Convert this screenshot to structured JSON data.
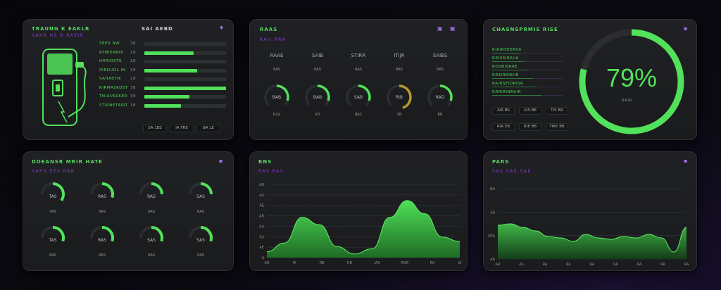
{
  "colors": {
    "accent": "#52e15b",
    "purple": "#8a3bd6",
    "panel": "#1d1e20",
    "amber": "#b59a2a"
  },
  "p1": {
    "title": "TRAUNG K EAKLR",
    "subtitle": "SAKR HS B RAEIR",
    "header_mid": "SAI AEBD",
    "icon": "battery-icon",
    "labels": [
      "SEER NW",
      "RTMIEANHI",
      "HRRIOSTE",
      "IRRDUOL IN",
      "SAHAETIK",
      "RIRMASKOST",
      "TNIAUSSKER",
      "STIRNETAIRT"
    ],
    "values": [
      "36",
      "18",
      "18",
      "18",
      "18",
      "38",
      "38",
      "18"
    ],
    "bars": [
      0.0,
      0.6,
      0.0,
      0.65,
      0.0,
      1.0,
      0.55,
      0.45
    ],
    "chips": [
      "SA 1EE",
      "IA FRE",
      "BA LE"
    ]
  },
  "p2": {
    "title": "RAAS",
    "subtitle": "RAH RRA",
    "gauges": [
      {
        "head": "RAAE",
        "sub": "RAS",
        "val": "BAB",
        "label": "R2G",
        "level": 0.3,
        "color": "#52e15b"
      },
      {
        "head": "SAIB",
        "sub": "RAS",
        "val": "BAB",
        "label": "R3",
        "level": 0.3,
        "color": "#52e15b"
      },
      {
        "head": "STIRR",
        "sub": "RAS",
        "val": "SAB",
        "label": "BA2",
        "level": 0.3,
        "color": "#52e15b"
      },
      {
        "head": "ITIJR",
        "sub": "RAS",
        "val": "RIB",
        "label": "ZB",
        "level": 0.45,
        "color": "#b59a2a"
      },
      {
        "head": "SAIBS",
        "sub": "RAS",
        "val": "RAD",
        "label": "BR",
        "level": 0.3,
        "color": "#52e15b"
      }
    ]
  },
  "p3": {
    "title": "CHASNSPRMIS RISE",
    "percent_label": "79%",
    "percent": 0.79,
    "gauge_caption": "RAIR",
    "rows": [
      "RIAIRSEERSA",
      "RRISSIRAIIA",
      "ROSNISRAE",
      "RRSIRAIEIIR",
      "RAIRSEIDRISR",
      "RRRIRINRAIR"
    ],
    "chips_row1": [
      "AIS BS",
      "UIS BE",
      "TIS BR"
    ],
    "chips_row2": [
      "RIA EB",
      "RIE BB",
      "TIRE BB"
    ]
  },
  "p4": {
    "title": "DOEANSR MRIR HATE",
    "subtitle": "SARS EES RAB",
    "gauges": [
      {
        "val": "TAS",
        "label": "SAS",
        "level": 0.35
      },
      {
        "val": "RAS",
        "label": "SAS",
        "level": 0.3
      },
      {
        "val": "RAS",
        "label": "SAS",
        "level": 0.25
      },
      {
        "val": "SAS",
        "label": "RAS",
        "level": 0.25
      },
      {
        "val": "TAS",
        "label": "RAS",
        "level": 0.3
      },
      {
        "val": "RAS",
        "label": "RAS",
        "level": 0.3
      },
      {
        "val": "SAS",
        "label": "RAS",
        "level": 0.3
      },
      {
        "val": "SAS",
        "label": "RAS",
        "level": 0.3
      }
    ]
  },
  "p5": {
    "title": "RNS",
    "subtitle": "RAS RAS",
    "yticks": [
      "AB",
      "AS",
      "AE",
      "AR",
      "AA",
      "RS",
      "AE",
      "A"
    ],
    "xticks": [
      "AR",
      "IA",
      "RB",
      "RB",
      "IAS",
      "ROR",
      "RA",
      "IA"
    ],
    "series": [
      0.08,
      0.2,
      0.55,
      0.45,
      0.15,
      0.05,
      0.12,
      0.55,
      0.78,
      0.6,
      0.28,
      0.22
    ]
  },
  "p6": {
    "title": "PARS",
    "subtitle": "SAS SAS SAE",
    "yticks": [
      "NA",
      "SA",
      "ARA",
      "AB"
    ],
    "xticks": [
      "AR",
      "AS",
      "RA",
      "RA",
      "RA",
      "RA",
      "RA",
      "RA",
      "RA"
    ],
    "series": [
      0.48,
      0.5,
      0.45,
      0.4,
      0.32,
      0.3,
      0.25,
      0.35,
      0.3,
      0.28,
      0.32,
      0.3,
      0.35,
      0.3,
      0.1,
      0.45
    ]
  }
}
